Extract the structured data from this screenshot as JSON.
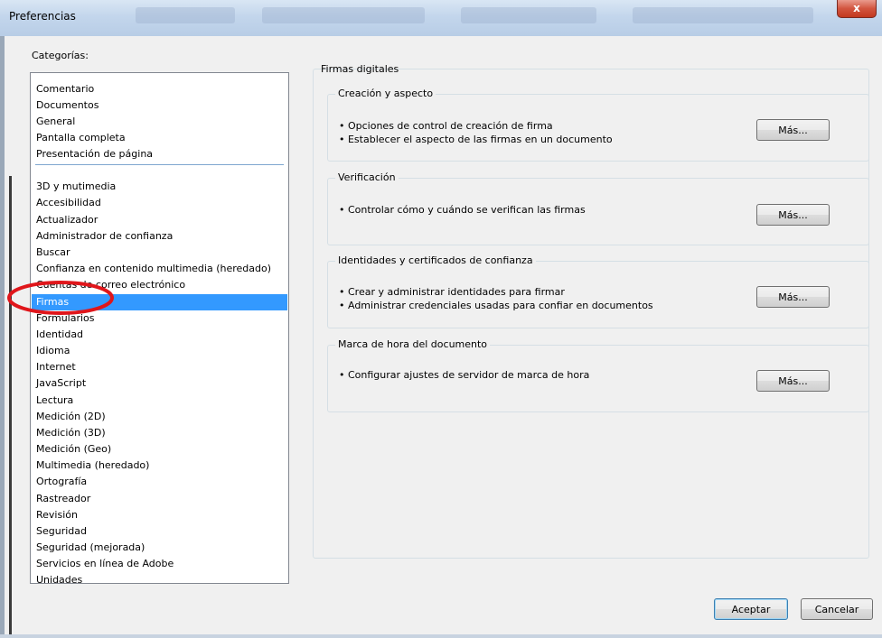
{
  "window": {
    "title": "Preferencias",
    "close_glyph": "x"
  },
  "categories": {
    "label": "Categorías:",
    "group_top": [
      "Comentario",
      "Documentos",
      "General",
      "Pantalla completa",
      "Presentación de página"
    ],
    "group_bottom": [
      "3D y mutimedia",
      "Accesibilidad",
      "Actualizador",
      "Administrador de confianza",
      "Buscar",
      "Confianza en contenido multimedia (heredado)",
      "Cuentas de correo electrónico",
      "Firmas",
      "Formularios",
      "Identidad",
      "Idioma",
      "Internet",
      "JavaScript",
      "Lectura",
      "Medición (2D)",
      "Medición (3D)",
      "Medición (Geo)",
      "Multimedia (heredado)",
      "Ortografía",
      "Rastreador",
      "Revisión",
      "Seguridad",
      "Seguridad (mejorada)",
      "Servicios en línea de Adobe",
      "Unidades"
    ],
    "selected": "Firmas"
  },
  "panel": {
    "title": "Firmas digitales",
    "groups": [
      {
        "title": "Creación y aspecto",
        "lines": [
          "• Opciones de control de creación de firma",
          "• Establecer el aspecto de las firmas en un documento"
        ],
        "button": "Más..."
      },
      {
        "title": "Verificación",
        "lines": [
          "• Controlar cómo y cuándo se verifican las firmas"
        ],
        "button": "Más..."
      },
      {
        "title": "Identidades y certificados de confianza",
        "lines": [
          "• Crear y administrar identidades para firmar",
          "• Administrar credenciales usadas para confiar en documentos"
        ],
        "button": "Más..."
      },
      {
        "title": "Marca de hora del documento",
        "lines": [
          "• Configurar ajustes de servidor de marca de hora"
        ],
        "button": "Más..."
      }
    ]
  },
  "footer": {
    "ok": "Aceptar",
    "cancel": "Cancelar"
  },
  "colors": {
    "selection": "#3399ff",
    "annotation": "#e0161b"
  }
}
